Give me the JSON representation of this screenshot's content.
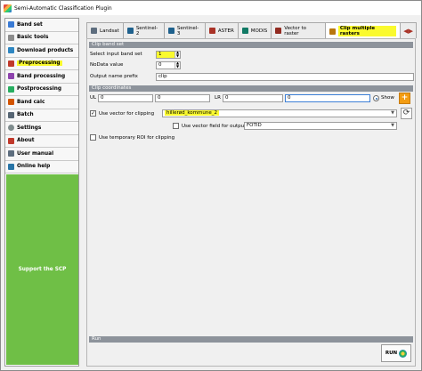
{
  "window": {
    "title": "Semi-Automatic Classification Plugin"
  },
  "sidebar": {
    "items": [
      {
        "label": "Band set",
        "icon": "band-set-icon",
        "color": "#3a7bd5"
      },
      {
        "label": "Basic tools",
        "icon": "basic-tools-icon",
        "color": "#8c8c8c"
      },
      {
        "label": "Download products",
        "icon": "download-icon",
        "color": "#2e86c1"
      },
      {
        "label": "Preprocessing",
        "icon": "preprocessing-icon",
        "color": "#c0392b"
      },
      {
        "label": "Band processing",
        "icon": "band-processing-icon",
        "color": "#8e44ad"
      },
      {
        "label": "Postprocessing",
        "icon": "postprocessing-icon",
        "color": "#27ae60"
      },
      {
        "label": "Band calc",
        "icon": "band-calc-icon",
        "color": "#d35400"
      },
      {
        "label": "Batch",
        "icon": "batch-icon",
        "color": "#566573"
      },
      {
        "label": "Settings",
        "icon": "settings-icon",
        "color": "#7f8c8d"
      },
      {
        "label": "About",
        "icon": "about-icon",
        "color": "#c0392b"
      },
      {
        "label": "User manual",
        "icon": "user-manual-icon",
        "color": "#5d6d7e"
      },
      {
        "label": "Online help",
        "icon": "online-help-icon",
        "color": "#2874a6"
      }
    ],
    "support": "Support the SCP"
  },
  "tabs": [
    {
      "label": "Landsat",
      "icon": "landsat-icon",
      "color": "#5d6d7e"
    },
    {
      "label": "Sentinel-2",
      "icon": "sentinel2-icon",
      "color": "#1f618d"
    },
    {
      "label": "Sentinel-3",
      "icon": "sentinel3-icon",
      "color": "#1f618d"
    },
    {
      "label": "ASTER",
      "icon": "aster-icon",
      "color": "#a93226"
    },
    {
      "label": "MODIS",
      "icon": "modis-icon",
      "color": "#117a65"
    },
    {
      "label": "Vector to raster",
      "icon": "vector-to-raster-icon",
      "color": "#922b21"
    },
    {
      "label": "Clip multiple rasters",
      "icon": "clip-icon",
      "color": "#b9770e"
    }
  ],
  "clip_band_set": {
    "header": "Clip band set",
    "input_band_set_label": "Select input band set",
    "input_band_set_value": "1",
    "nodata_label": "NoData value",
    "nodata_value": "0",
    "prefix_label": "Output name prefix",
    "prefix_value": "clip"
  },
  "clip_coordinates": {
    "header": "Clip coordinates",
    "ul_label": "UL",
    "ul_x": "0",
    "ul_y": "0",
    "lr_label": "LR",
    "lr_x": "0",
    "lr_y": "0",
    "show_label": "Show",
    "use_vector_label": "Use vector for clipping",
    "use_vector_checked": true,
    "vector_value": "hillerød_kommune_2",
    "use_vector_field_label": "Use vector field for output name",
    "field_value": "FOTID",
    "temp_roi_label": "Use temporary ROI for clipping"
  },
  "run": {
    "header": "Run",
    "button_label": "RUN"
  },
  "colors": {
    "highlight": "#fafa2e",
    "support_bg": "#6fbf46",
    "section_header": "#8d939b"
  }
}
